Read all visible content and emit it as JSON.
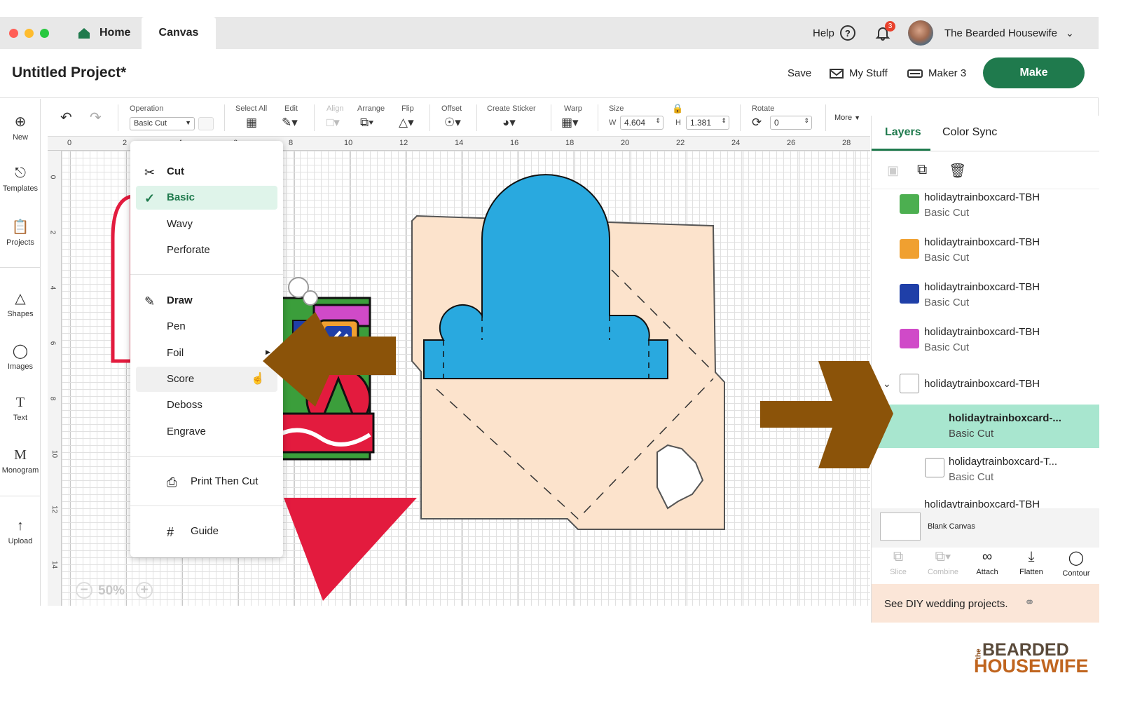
{
  "window": {
    "tab_home": "Home",
    "tab_canvas": "Canvas",
    "help": "Help",
    "notification_count": "3",
    "user_name": "The Bearded Housewife"
  },
  "header": {
    "project_title": "Untitled Project*",
    "save": "Save",
    "my_stuff": "My Stuff",
    "machine": "Maker 3",
    "make": "Make"
  },
  "toolbar": {
    "operation_label": "Operation",
    "operation_value": "Basic Cut",
    "select_all": "Select All",
    "edit": "Edit",
    "align": "Align",
    "arrange": "Arrange",
    "flip": "Flip",
    "offset": "Offset",
    "create_sticker": "Create Sticker",
    "warp": "Warp",
    "size": "Size",
    "w_label": "W",
    "w_value": "4.604",
    "h_label": "H",
    "h_value": "1.381",
    "rotate": "Rotate",
    "rotate_value": "0",
    "more": "More"
  },
  "leftbar": {
    "new": "New",
    "templates": "Templates",
    "projects": "Projects",
    "shapes": "Shapes",
    "images": "Images",
    "text": "Text",
    "monogram": "Monogram",
    "upload": "Upload"
  },
  "ruler": {
    "top": [
      "0",
      "2",
      "4",
      "6",
      "8",
      "10",
      "12",
      "14",
      "16",
      "18",
      "20",
      "22",
      "24",
      "26",
      "28"
    ],
    "left": [
      "0",
      "2",
      "4",
      "6",
      "8",
      "10",
      "12",
      "14"
    ]
  },
  "operation_menu": {
    "cut_header": "Cut",
    "basic": "Basic",
    "wavy": "Wavy",
    "perforate": "Perforate",
    "draw_header": "Draw",
    "pen": "Pen",
    "foil": "Foil",
    "score": "Score",
    "deboss": "Deboss",
    "engrave": "Engrave",
    "print_then_cut": "Print Then Cut",
    "guide": "Guide"
  },
  "zoom": {
    "level": "50%"
  },
  "panel": {
    "tab_layers": "Layers",
    "tab_color_sync": "Color Sync",
    "layers": [
      {
        "name": "holidaytrainboxcard-TBH",
        "op": "Basic Cut",
        "color": "#4caf50"
      },
      {
        "name": "holidaytrainboxcard-TBH",
        "op": "Basic Cut",
        "color": "#f0a030"
      },
      {
        "name": "holidaytrainboxcard-TBH",
        "op": "Basic Cut",
        "color": "#1f3fa8"
      },
      {
        "name": "holidaytrainboxcard-TBH",
        "op": "Basic Cut",
        "color": "#d04ac8"
      }
    ],
    "group_name": "holidaytrainboxcard-TBH",
    "child_selected": {
      "name": "holidaytrainboxcard-...",
      "op": "Basic Cut"
    },
    "child_2": {
      "name": "holidaytrainboxcard-T...",
      "op": "Basic Cut"
    },
    "partial_layer": "holidaytrainboxcard-TBH",
    "blank_canvas": "Blank Canvas",
    "actions": {
      "slice": "Slice",
      "combine": "Combine",
      "attach": "Attach",
      "flatten": "Flatten",
      "contour": "Contour"
    },
    "promo": "See DIY wedding projects."
  },
  "brand": {
    "the": "the",
    "line1": "BEARDED",
    "line2": "HOUSEWIFE"
  },
  "colors": {
    "accent": "#1f7a4d",
    "selected_row": "#a8e6cf",
    "arrow": "#8b5309",
    "envelope": "#fce3cc",
    "blue": "#29a9df",
    "red": "#e31b3e"
  }
}
